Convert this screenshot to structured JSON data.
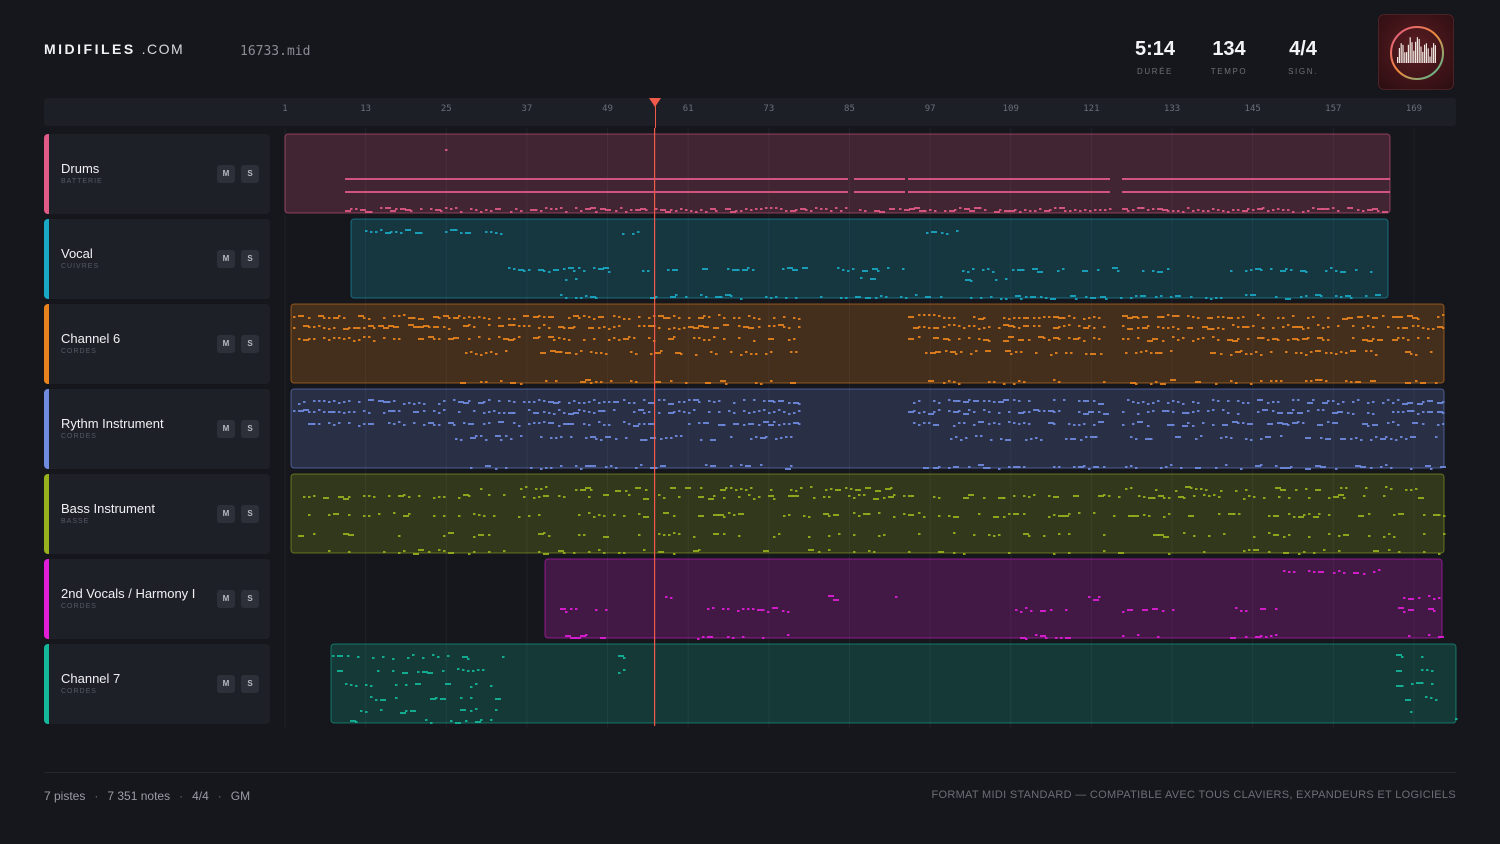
{
  "brand": {
    "name": "MIDIFILES",
    "domain": ".COM"
  },
  "file": {
    "name": "16733.mid"
  },
  "stats": [
    {
      "value": "5:14",
      "label": "DURÉE"
    },
    {
      "value": "134",
      "label": "TEMPO"
    },
    {
      "value": "4/4",
      "label": "SIGN."
    }
  ],
  "ruler": {
    "ticks": [
      "1",
      "13",
      "25",
      "37",
      "49",
      "61",
      "73",
      "85",
      "97",
      "109",
      "121",
      "133",
      "145",
      "157",
      "169"
    ]
  },
  "playhead": {
    "bar": 56
  },
  "tracks": [
    {
      "name": "Drums",
      "category": "BATTERIE",
      "color": "#e05a86",
      "mute": "M",
      "solo": "S"
    },
    {
      "name": "Vocal",
      "category": "CUIVRES",
      "color": "#19a9c4",
      "mute": "M",
      "solo": "S"
    },
    {
      "name": "Channel 6",
      "category": "CORDES",
      "color": "#e8821e",
      "mute": "M",
      "solo": "S"
    },
    {
      "name": "Rythm Instrument",
      "category": "CORDES",
      "color": "#6f8be0",
      "mute": "M",
      "solo": "S"
    },
    {
      "name": "Bass Instrument",
      "category": "BASSE",
      "color": "#97b01e",
      "mute": "M",
      "solo": "S"
    },
    {
      "name": "2nd Vocals / Harmony I",
      "category": "CORDES",
      "color": "#e01ed8",
      "mute": "M",
      "solo": "S"
    },
    {
      "name": "Channel 7",
      "category": "CORDES",
      "color": "#14b79a",
      "mute": "M",
      "solo": "S"
    }
  ],
  "footer": {
    "tracks": "7 pistes",
    "notes": "7 351 notes",
    "signature": "4/4",
    "standard": "GM",
    "note": "FORMAT MIDI STANDARD — COMPATIBLE AVEC TOUS CLAVIERS, EXPANDEURS ET LOGICIELS"
  }
}
